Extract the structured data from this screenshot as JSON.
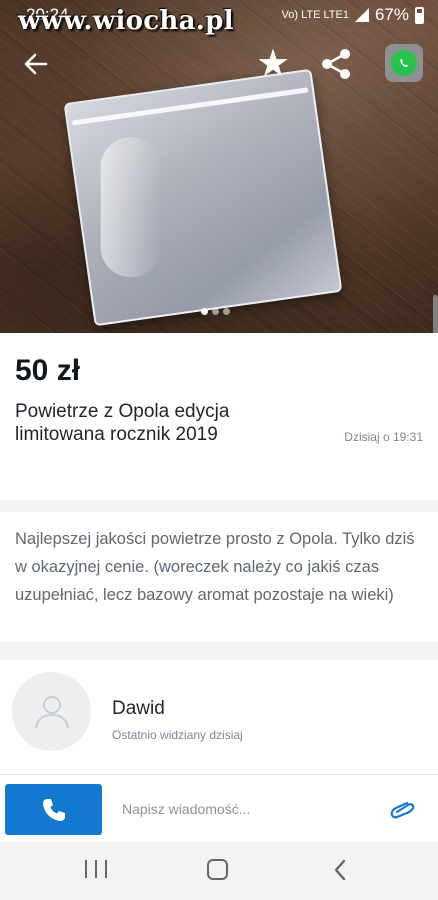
{
  "status_bar": {
    "time": "20:24",
    "watermark": "www.wiocha.pl",
    "network": "Vo) LTE LTE1",
    "battery": "67%"
  },
  "hero": {
    "photo_count": 3,
    "active_photo": 1
  },
  "listing": {
    "price": "50 zł",
    "title": "Powietrze z Opola edycja limitowana rocznik 2019",
    "posted": "Dzisiaj o 19:31",
    "description": "Najlepszej jakości powietrze prosto z Opola. Tylko dziś w okazyjnej cenie. (woreczek należy co jakiś czas uzupełniać, lecz bazowy aromat pozostaje na wieki)"
  },
  "seller": {
    "name": "Dawid",
    "last_seen": "Ostatnio widziany dzisiaj"
  },
  "message_bar": {
    "placeholder": "Napisz wiadomość..."
  },
  "colors": {
    "accent_blue": "#1379d0",
    "whatsapp_green": "#27c24c",
    "text_dark": "#0f1720",
    "text_muted": "#7c8793"
  },
  "icons": [
    "back-arrow-icon",
    "star-icon",
    "share-icon",
    "whatsapp-icon",
    "user-avatar-icon",
    "phone-icon",
    "paperclip-icon",
    "recent-apps-icon",
    "home-icon",
    "nav-back-icon"
  ]
}
